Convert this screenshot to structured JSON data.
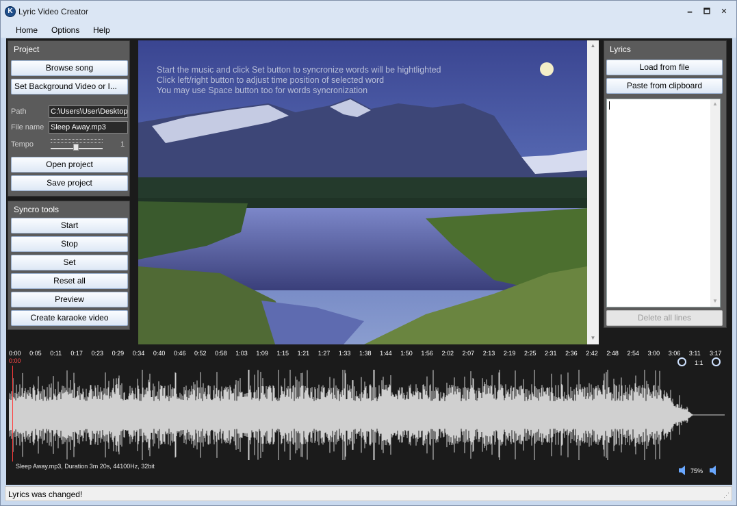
{
  "window": {
    "title": "Lyric Video Creator",
    "minimize": "🗕",
    "maximize": "🗖",
    "close": "✕"
  },
  "menu": [
    "Home",
    "Options",
    "Help"
  ],
  "project": {
    "title": "Project",
    "browse_song": "Browse song",
    "set_background": "Set Background Video or I...",
    "path_label": "Path",
    "path_value": "C:\\Users\\User\\Desktop",
    "filename_label": "File name",
    "filename_value": "Sleep Away.mp3",
    "tempo_label": "Tempo",
    "tempo_value": "1",
    "open_project": "Open project",
    "save_project": "Save project"
  },
  "syncro": {
    "title": "Syncro tools",
    "start": "Start",
    "stop": "Stop",
    "set": "Set",
    "reset_all": "Reset all",
    "preview": "Preview",
    "create_karaoke": "Create karaoke video"
  },
  "video": {
    "hints": [
      "Start the music and click Set button to syncronize words will be hightlighted",
      "Click left/right button to adjust time position of selected word",
      "You may use Space button too for words syncronization"
    ]
  },
  "lyrics": {
    "title": "Lyrics",
    "load_from_file": "Load from file",
    "paste_from_clipboard": "Paste from clipboard",
    "delete_all_lines": "Delete all lines"
  },
  "timeline": {
    "ticks": [
      "0:00",
      "0:05",
      "0:11",
      "0:17",
      "0:23",
      "0:29",
      "0:34",
      "0:40",
      "0:46",
      "0:52",
      "0:58",
      "1:03",
      "1:09",
      "1:15",
      "1:21",
      "1:27",
      "1:33",
      "1:38",
      "1:44",
      "1:50",
      "1:56",
      "2:02",
      "2:07",
      "2:13",
      "2:19",
      "2:25",
      "2:31",
      "2:36",
      "2:42",
      "2:48",
      "2:54",
      "3:00",
      "3:06",
      "3:11",
      "3:17"
    ],
    "position": "0:00",
    "zoom_ratio": "1:1",
    "file_info": "Sleep Away.mp3, Duration 3m 20s, 44100Hz, 32bit",
    "volume": "75%"
  },
  "status": {
    "message": "Lyrics was changed!"
  },
  "colors": {
    "waveform": "#d0d0d0",
    "playhead": "#ff3b3b",
    "panel_bg": "#5b5b5b"
  }
}
